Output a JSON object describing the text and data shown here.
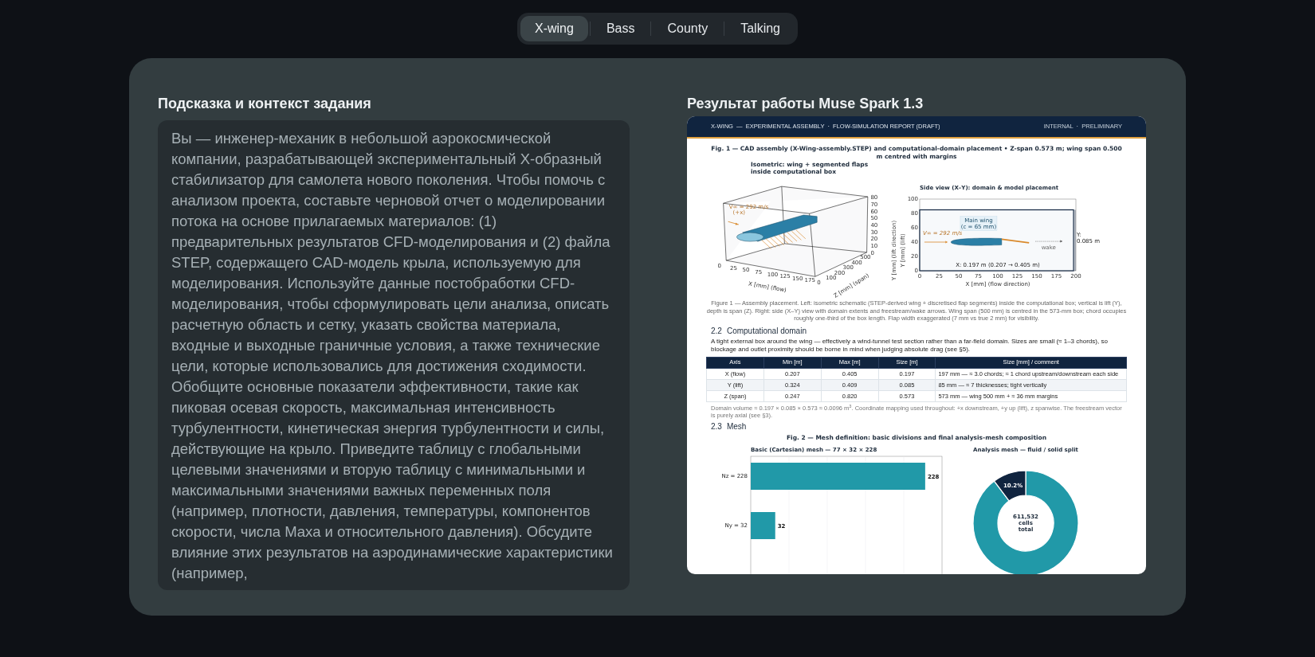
{
  "tabs": [
    {
      "label": "X-wing",
      "selected": true
    },
    {
      "label": "Bass",
      "selected": false
    },
    {
      "label": "County",
      "selected": false
    },
    {
      "label": "Talking",
      "selected": false
    }
  ],
  "prompt": {
    "heading": "Подсказка и контекст задания",
    "text": "Вы — инженер-механик в небольшой аэрокосмической компании, разрабатывающей экспериментальный X-образный стабилизатор для самолета нового поколения. Чтобы помочь с анализом проекта, составьте черновой отчет о моделировании потока на основе прилагаемых материалов: (1) предварительных результатов CFD-моделирования и (2) файла STEP, содержащего CAD-модель крыла, используемую для моделирования. Используйте данные постобработки CFD-моделирования, чтобы сформулировать цели анализа, описать расчетную область и сетку, указать свойства материала, входные и выходные граничные условия, а также технические цели, которые использовались для достижения сходимости. Обобщите основные показатели эффективности, такие как пиковая осевая скорость, максимальная интенсивность турбулентности, кинетическая энергия турбулентности и силы, действующие на крыло. Приведите таблицу с глобальными целевыми значениями и вторую таблицу с минимальными и максимальными значениями важных переменных поля (например, плотности, давления, температуры, компонентов скорости, числа Маха и относительного давления). Обсудите влияние этих результатов на аэродинамические характеристики (например,"
  },
  "result": {
    "heading": "Результат работы Muse Spark 1.3",
    "report": {
      "header": {
        "title": "X-WING  —  EXPERIMENTAL ASSEMBLY  ·  FLOW-SIMULATION REPORT (DRAFT)",
        "tag": "INTERNAL  ·  PRELIMINARY"
      },
      "figure_1": {
        "title": "Fig. 1 — CAD assembly (X-Wing-assembly.STEP) and computational-domain placement  •  Z-span 0.573 m;  wing span 0.500 m centred with margins",
        "isometric": {
          "caption": [
            "Isometric: wing + segmented flaps",
            "inside computational box"
          ],
          "flow_label": [
            "V∞ = 292 m/s",
            "(+x)"
          ],
          "x_ticks": [
            "0",
            "25",
            "50",
            "75",
            "100",
            "125",
            "150",
            "175"
          ],
          "y_ticks": [
            "80",
            "70",
            "60",
            "50",
            "40",
            "30",
            "20",
            "10",
            "0"
          ],
          "z_ticks": [
            "0",
            "100",
            "200",
            "300",
            "400",
            "500"
          ],
          "x_label": "X [mm] (flow)",
          "y_label": "Y [mm]  (lift direction)",
          "z_label": "Z [mm] (span)"
        },
        "side_view": {
          "title": "Side view (X–Y): domain & model placement",
          "x_ticks": [
            "0",
            "25",
            "50",
            "75",
            "100",
            "125",
            "150",
            "175",
            "200"
          ],
          "y_ticks": [
            "100",
            "80",
            "60",
            "40",
            "20",
            "0"
          ],
          "x_label": "X [mm]  (flow direction)",
          "y_label": "Y [mm] (lift)",
          "wing_label": [
            "Main wing",
            "(c = 65 mm)"
          ],
          "flow_label": "V∞ = 292 m/s",
          "wake_label": "wake",
          "height_label": [
            "Y:",
            "0.085 m"
          ],
          "length_label": "X: 0.197 m (0.207 → 0.405 m)"
        },
        "caption": "Figure 1 — Assembly placement. Left: isometric schematic (STEP-derived wing + discretised flap segments) inside the computational box; vertical is lift (Y), depth is span (Z). Right: side (X–Y) view with domain extents and freestream/wake arrows. Wing span (500 mm) is centred in the 573-mm box; chord occupies roughly one-third of the box length. Flap width exaggerated (7 mm vs true 2 mm) for visibility."
      },
      "domain": {
        "number": "2.2",
        "title": "Computational domain",
        "text": "A tight external box around the wing — effectively a wind-tunnel test section rather than a far-field domain. Sizes are small (≈ 1–3 chords), so blockage and outlet proximity should be borne in mind when judging absolute drag (see §5).",
        "table": {
          "columns": [
            "Axis",
            "Min [m]",
            "Max [m]",
            "Size [m]",
            "Size [mm] / comment"
          ],
          "rows": [
            [
              "X (flow)",
              "0.207",
              "0.405",
              "0.197",
              "197 mm — ≈ 3.0 chords; ≈ 1 chord upstream/downstream each side"
            ],
            [
              "Y (lift)",
              "0.324",
              "0.409",
              "0.085",
              "85 mm — ≈ 7 thicknesses; tight vertically"
            ],
            [
              "Z (span)",
              "0.247",
              "0.820",
              "0.573",
              "573 mm — wing 500 mm + ≈ 36 mm margins"
            ]
          ]
        },
        "note": "Domain volume ≈ 0.197 × 0.085 × 0.573 ≈ 0.0096 m$^{3}$. Coordinate mapping used throughout: +x downstream, +y up (lift), z spanwise. The freestream vector is purely axial (see §3)."
      },
      "mesh": {
        "number": "2.3",
        "title": "Mesh",
        "figure_title": "Fig. 2 — Mesh definition: basic divisions and final analysis-mesh composition",
        "bar_chart": {
          "chart_data": {
            "type": "bar",
            "orientation": "horizontal",
            "title": "Basic (Cartesian) mesh — 77 × 32 × 228",
            "categories": [
              "Nz = 228",
              "Ny = 32"
            ],
            "series": [
              {
                "color": "#2199a8",
                "values": [
                  228,
                  32
                ]
              }
            ],
            "xlim": [
              0,
              250
            ],
            "data_labels": true
          }
        },
        "donut_chart": {
          "chart_data": {
            "type": "donut",
            "title": "Analysis mesh — fluid / solid split",
            "values": [
              89.8,
              10.2
            ],
            "colors": [
              "#2199a8",
              "#10243f"
            ],
            "value_labels": [
              null,
              "10.2%"
            ],
            "annotations": [
              "611,532",
              "cells",
              "total"
            ]
          }
        }
      }
    }
  }
}
